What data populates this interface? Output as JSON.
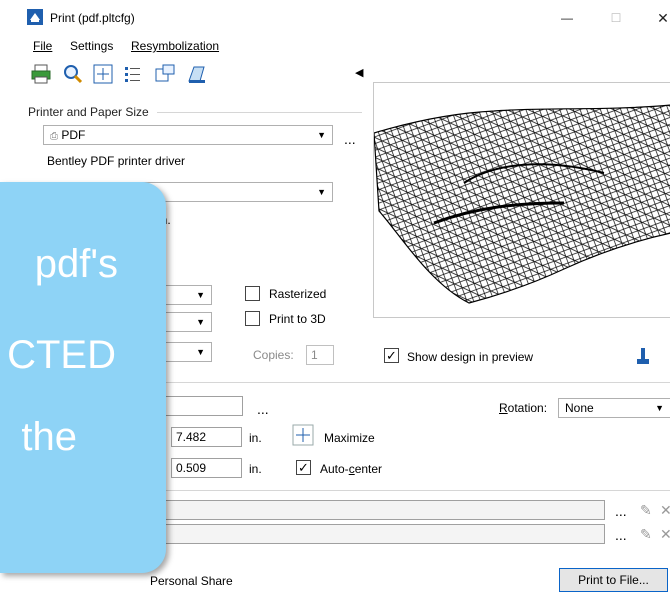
{
  "window": {
    "title": "Print  (pdf.pltcfg)",
    "minimize_glyph": "—",
    "maximize_glyph": "☐",
    "close_glyph": "✕"
  },
  "menu": {
    "file": "File",
    "settings": "Settings",
    "resymbolization": "Resymbolization"
  },
  "toolbar": {
    "icons": [
      "print-icon",
      "preview-icon",
      "fit-icon",
      "list-icon",
      "layout-icon",
      "plot-icon"
    ],
    "collapse_glyph": "◀"
  },
  "printer": {
    "group_label": "Printer and Paper Size",
    "printer_value": "PDF",
    "more": "...",
    "driver": "Bentley PDF printer driver",
    "paper_value": "",
    "size_fragment": "5 in."
  },
  "options": {
    "rasterized_label": "Rasterized",
    "rasterized_checked": false,
    "print3d_label": "Print to 3D",
    "print3d_checked": false,
    "copies_label": "Copies:",
    "copies_value": "1",
    "show_design_label": "Show design in preview",
    "show_design_checked": true
  },
  "layout": {
    "more": "...",
    "rotation_label": "Rotation:",
    "rotation_value": "None",
    "value1": "7.482",
    "unit1": "in.",
    "maximize_label": "Maximize",
    "value2": "0.509",
    "unit2": "in.",
    "autocenter_label": "Auto-center",
    "autocenter_checked": true
  },
  "bottom": {
    "more1": "...",
    "more2": "...",
    "personal_share": "Personal Share",
    "print_to_file": "Print to File..."
  },
  "overlay": {
    "line1": "pdf's",
    "line2": "CTED",
    "line3": "the"
  }
}
